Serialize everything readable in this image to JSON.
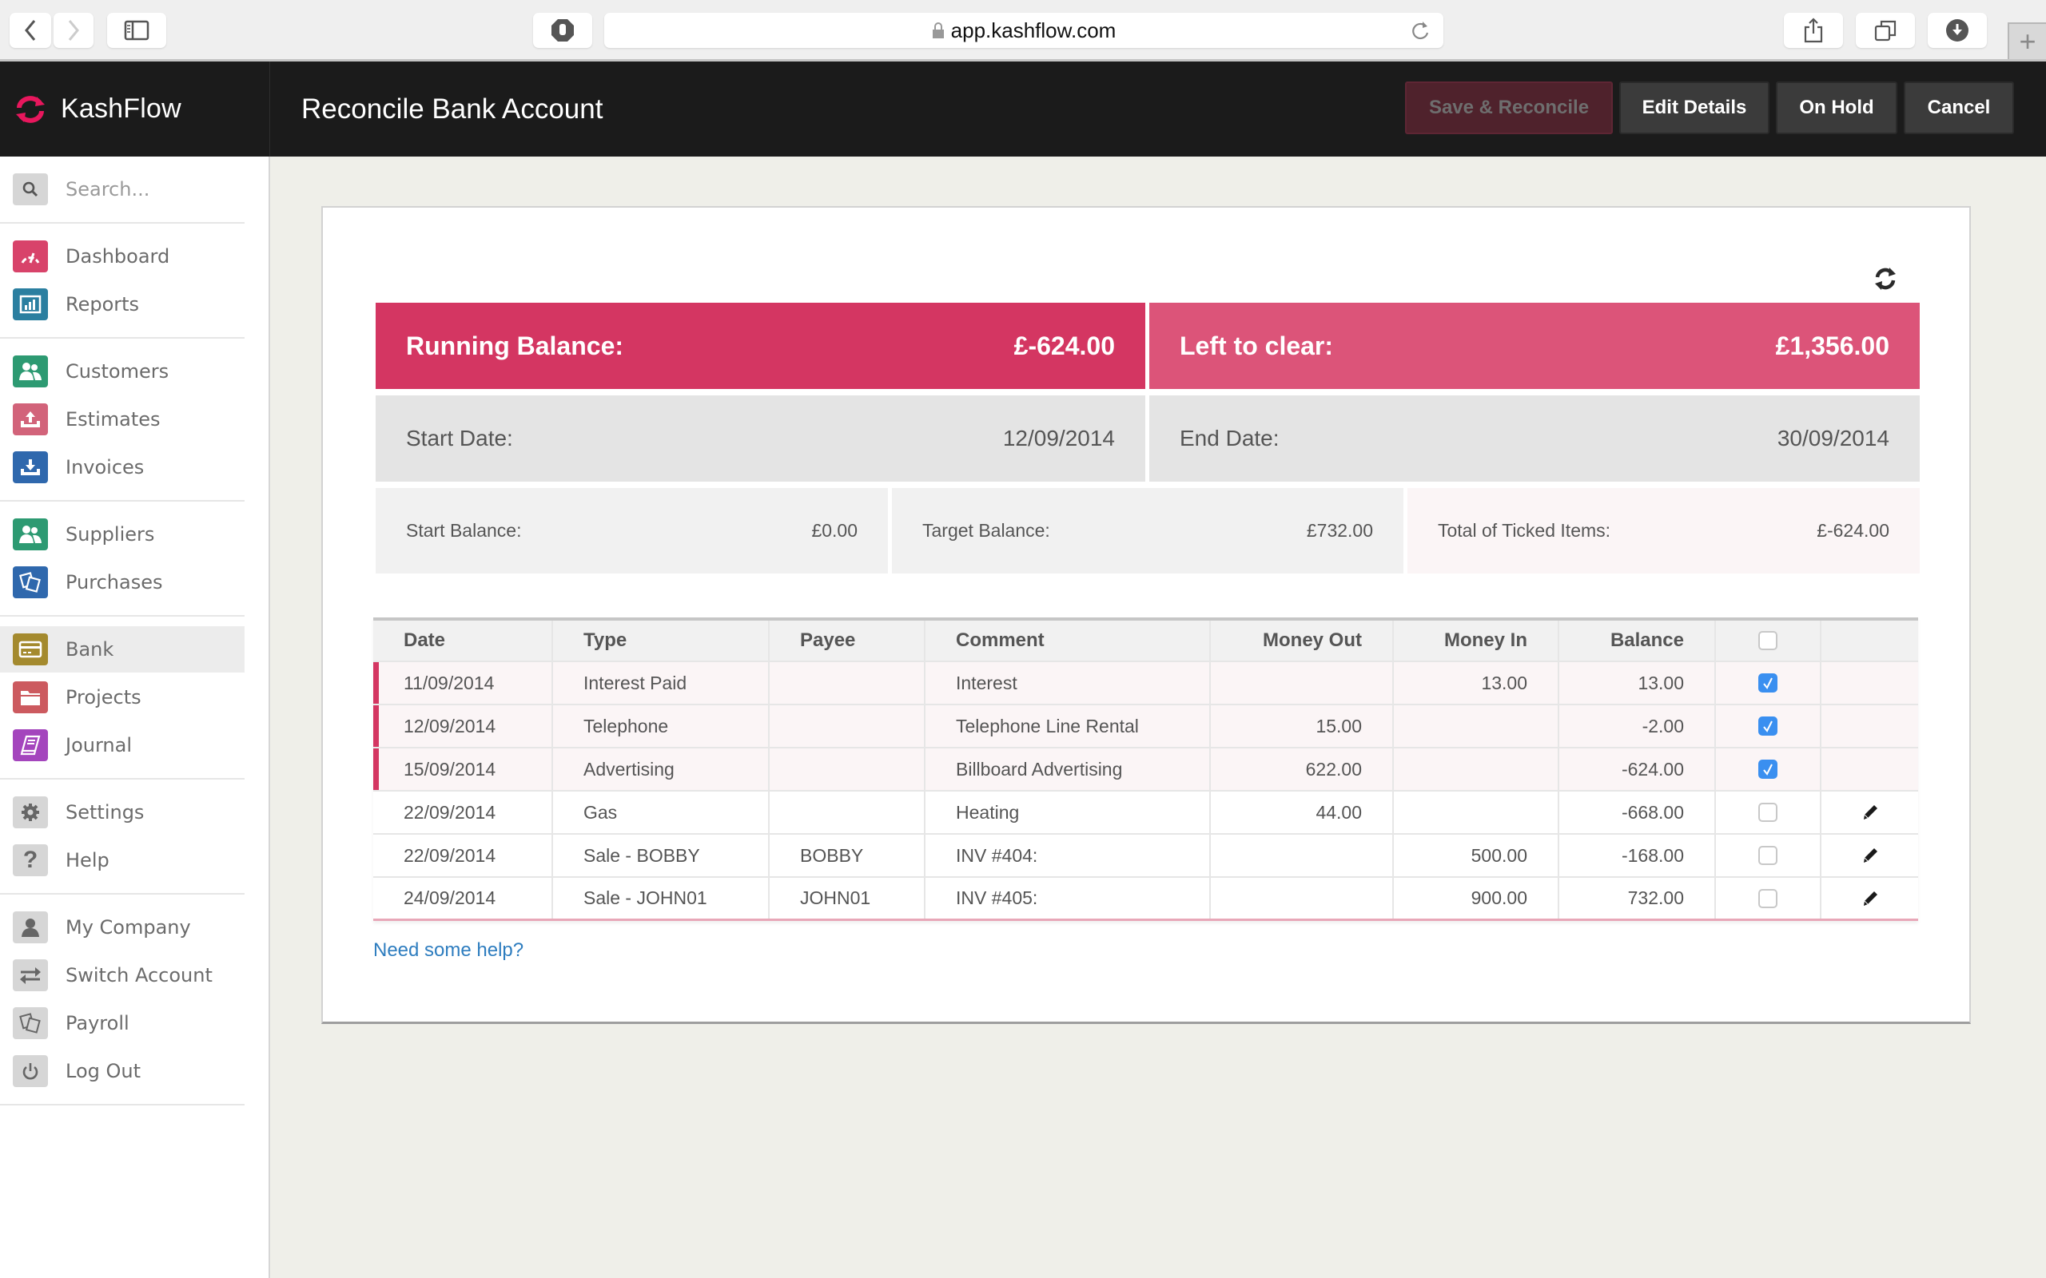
{
  "browser": {
    "url": "app.kashflow.com",
    "new_tab_label": "+"
  },
  "header": {
    "brand": "KashFlow",
    "title": "Reconcile Bank Account",
    "buttons": {
      "save_reconcile": "Save & Reconcile",
      "edit_details": "Edit Details",
      "on_hold": "On Hold",
      "cancel": "Cancel"
    }
  },
  "sidebar": {
    "search_placeholder": "Search...",
    "items": [
      {
        "label": "Dashboard",
        "icon": "dashboard-gauge-icon",
        "color": "#d8436a"
      },
      {
        "label": "Reports",
        "icon": "reports-chart-icon",
        "color": "#2b7fa0"
      },
      {
        "label": "Customers",
        "icon": "customers-people-icon",
        "color": "#2d9a72"
      },
      {
        "label": "Estimates",
        "icon": "estimates-upload-icon",
        "color": "#d2637a"
      },
      {
        "label": "Invoices",
        "icon": "invoices-download-icon",
        "color": "#2f68ad"
      },
      {
        "label": "Suppliers",
        "icon": "suppliers-people-icon",
        "color": "#2d9a72"
      },
      {
        "label": "Purchases",
        "icon": "purchases-cards-icon",
        "color": "#2f68ad"
      },
      {
        "label": "Bank",
        "icon": "bank-card-icon",
        "color": "#a48a2e",
        "active": true
      },
      {
        "label": "Projects",
        "icon": "projects-folder-icon",
        "color": "#cc5a5f"
      },
      {
        "label": "Journal",
        "icon": "journal-book-icon",
        "color": "#a445bd"
      },
      {
        "label": "Settings",
        "icon": "gear-icon",
        "color": "#d6d6d6"
      },
      {
        "label": "Help",
        "icon": "help-question-icon",
        "color": "#d6d6d6"
      },
      {
        "label": "My Company",
        "icon": "user-icon",
        "color": "#d6d6d6"
      },
      {
        "label": "Switch Account",
        "icon": "switch-arrows-icon",
        "color": "#d6d6d6"
      },
      {
        "label": "Payroll",
        "icon": "payroll-cards-icon",
        "color": "#d6d6d6"
      },
      {
        "label": "Log Out",
        "icon": "power-icon",
        "color": "#d6d6d6"
      }
    ]
  },
  "summary": {
    "running_balance_label": "Running Balance:",
    "running_balance_value": "£-624.00",
    "left_to_clear_label": "Left to clear:",
    "left_to_clear_value": "£1,356.00",
    "start_date_label": "Start Date:",
    "start_date_value": "12/09/2014",
    "end_date_label": "End Date:",
    "end_date_value": "30/09/2014",
    "start_balance_label": "Start Balance:",
    "start_balance_value": "£0.00",
    "target_balance_label": "Target Balance:",
    "target_balance_value": "£732.00",
    "total_ticked_label": "Total of Ticked Items:",
    "total_ticked_value": "£-624.00"
  },
  "table": {
    "columns": [
      "Date",
      "Type",
      "Payee",
      "Comment",
      "Money Out",
      "Money In",
      "Balance"
    ],
    "select_all_checked": false,
    "rows": [
      {
        "date": "11/09/2014",
        "type": "Interest Paid",
        "payee": "",
        "comment": "Interest",
        "money_out": "",
        "money_in": "13.00",
        "balance": "13.00",
        "ticked": true,
        "editable": false
      },
      {
        "date": "12/09/2014",
        "type": "Telephone",
        "payee": "",
        "comment": "Telephone Line Rental",
        "money_out": "15.00",
        "money_in": "",
        "balance": "-2.00",
        "ticked": true,
        "editable": false
      },
      {
        "date": "15/09/2014",
        "type": "Advertising",
        "payee": "",
        "comment": "Billboard Advertising",
        "money_out": "622.00",
        "money_in": "",
        "balance": "-624.00",
        "ticked": true,
        "editable": false
      },
      {
        "date": "22/09/2014",
        "type": "Gas",
        "payee": "",
        "comment": "Heating",
        "money_out": "44.00",
        "money_in": "",
        "balance": "-668.00",
        "ticked": false,
        "editable": true
      },
      {
        "date": "22/09/2014",
        "type": "Sale - BOBBY",
        "payee": "BOBBY",
        "comment": "INV #404:",
        "money_out": "",
        "money_in": "500.00",
        "balance": "-168.00",
        "ticked": false,
        "editable": true
      },
      {
        "date": "24/09/2014",
        "type": "Sale - JOHN01",
        "payee": "JOHN01",
        "comment": "INV #405:",
        "money_out": "",
        "money_in": "900.00",
        "balance": "732.00",
        "ticked": false,
        "editable": true
      }
    ]
  },
  "help_link": "Need some help?",
  "colors": {
    "brand_pink": "#e8175d",
    "running_balance_bg": "#d43662",
    "left_to_clear_bg": "#dc5479",
    "checkbox_checked": "#3a8ff0",
    "link": "#2e7dbf"
  }
}
